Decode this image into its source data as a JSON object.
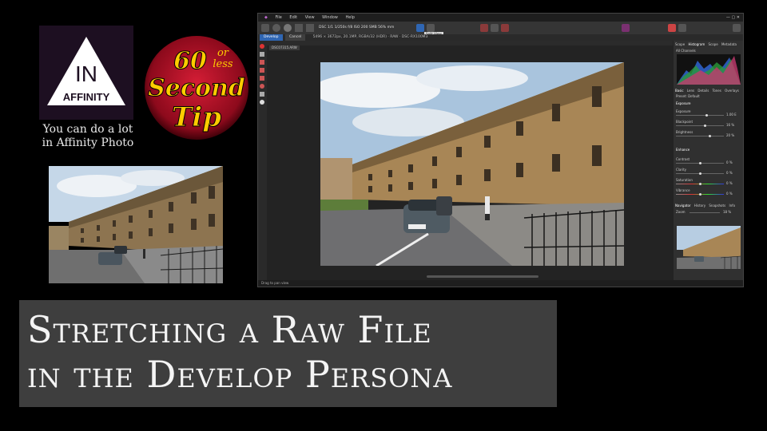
{
  "logo": {
    "line1": "IN",
    "line2": "AFFINITY"
  },
  "tagline": {
    "line1": "You can do a lot",
    "line2": "in Affinity Photo"
  },
  "badge": {
    "number": "60",
    "or_less_1": "or",
    "or_less_2": "less",
    "word1": "Second",
    "word2": "Tip"
  },
  "title": {
    "line1": "Stretching a Raw File",
    "line2": "in the Develop Persona"
  },
  "app": {
    "menu": [
      "File",
      "Edit",
      "View",
      "Window",
      "Help"
    ],
    "camera_info": "DSC 1/1 1/250s f/8 ISO 200 SMB 56% mm",
    "develop_button": "Develop",
    "cancel_button": "Cancel",
    "file_info": "5496 × 3672px, 20.1MP, RGBA/32 (HDR) · RAW · DSC-RX100M3",
    "tooltip": "Split View",
    "doc_tab": "DSC07315.ARW",
    "panel_tabs": [
      "Scope",
      "Histogram",
      "Scope",
      "Metadata"
    ],
    "histogram_channel": "All Channels",
    "adjust_tabs": [
      "Basic",
      "Lens",
      "Details",
      "Tones",
      "Overlays"
    ],
    "preset": "Preset: Default",
    "exposure_section": "Exposure",
    "exposure_slider_label": "Exposure",
    "exposure_value": "1.00 E",
    "blackpoint_label": "Blackpoint",
    "blackpoint_value": "16 %",
    "brightness_label": "Brightness",
    "brightness_value": "20 %",
    "enhance_section": "Enhance",
    "contrast_label": "Contrast",
    "contrast_value": "0 %",
    "clarity_label": "Clarity",
    "clarity_value": "0 %",
    "saturation_label": "Saturation",
    "saturation_value": "0 %",
    "vibrance_label": "Vibrance",
    "vibrance_value": "0 %",
    "nav_tabs": [
      "Navigator",
      "History",
      "Snapshots",
      "Info"
    ],
    "zoom_label": "Zoom",
    "zoom_value": "18 %",
    "status_text": "Drag to pan view"
  },
  "colors": {
    "accent": "#2f66b3",
    "badge_red": "#c8102e",
    "badge_text": "#ffcc00",
    "logo_bg": "#1d0f21"
  }
}
